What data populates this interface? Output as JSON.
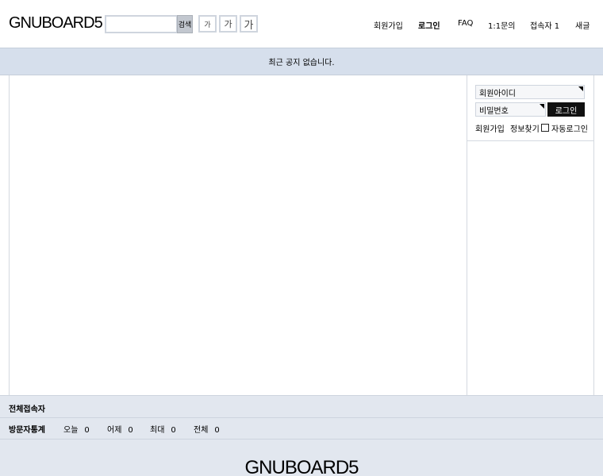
{
  "header": {
    "logo": "GNUBOARD5",
    "search": {
      "placeholder": "",
      "button_label": "검색"
    },
    "font_buttons": [
      "가",
      "가",
      "가"
    ],
    "nav": [
      "회원가입",
      "로그인",
      "FAQ",
      "1:1문의",
      "접속자 1",
      "새글"
    ]
  },
  "notice": "최근 공지 없습니다.",
  "login": {
    "id_placeholder": "회원아이디",
    "pw_placeholder": "비밀번호",
    "submit_label": "로그인",
    "join_link": "회원가입",
    "find_link": "정보찾기",
    "auto_login_label": "자동로그인"
  },
  "footer": {
    "row1_label": "전체접속자",
    "row2_label": "방문자통계",
    "stats": [
      {
        "label": "오늘",
        "value": "0"
      },
      {
        "label": "어제",
        "value": "0"
      },
      {
        "label": "최대",
        "value": "0"
      },
      {
        "label": "전체",
        "value": "0"
      }
    ],
    "logo": "GNUBOARD5"
  }
}
